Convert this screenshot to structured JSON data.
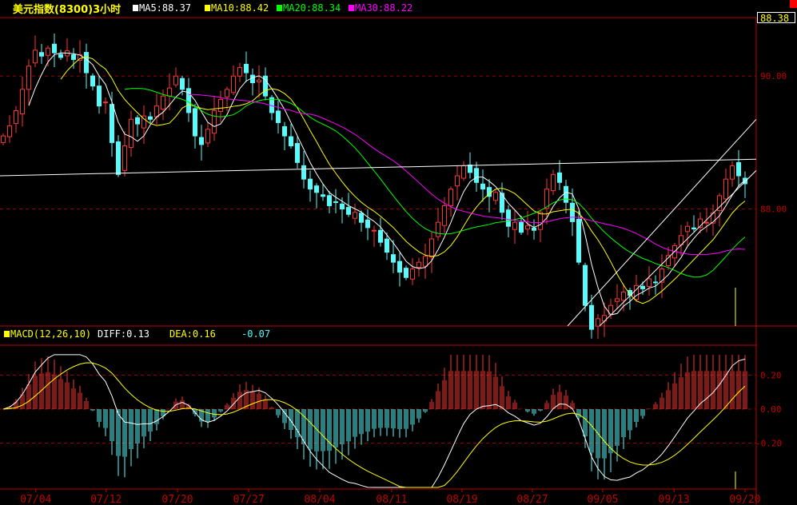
{
  "header": {
    "title": "美元指数(8300)3小时",
    "ma5": "MA5:88.37",
    "ma10": "MA10:88.42",
    "ma20": "MA20:88.34",
    "ma30": "MA30:88.22",
    "current_price": "88.38"
  },
  "macd_header": {
    "name": "MACD(12,26,10)",
    "diff": "DIFF:0.13",
    "dea": "DEA:0.16",
    "macd": "-0.07"
  },
  "colors": {
    "up": "#ff3232",
    "down": "#54fcfc",
    "ma5": "#ffffff",
    "ma10": "#ffff00",
    "ma20": "#00ff00",
    "ma30": "#ff00ff",
    "grid": "#a00000",
    "axis": "#c00000"
  },
  "chart_data": [
    {
      "type": "candlestick",
      "title": "美元指数(8300)3小时",
      "ylim": [
        86.24,
        90.88
      ],
      "yticks": [
        {
          "value": 90,
          "label": "90.00"
        },
        {
          "value": 88,
          "label": "88.00"
        }
      ],
      "closes": [
        89.1,
        89.25,
        89.48,
        89.8,
        90.15,
        90.39,
        90.3,
        90.42,
        90.35,
        90.28,
        90.38,
        90.25,
        90.32,
        90.05,
        89.85,
        89.55,
        89.61,
        89.0,
        88.52,
        88.95,
        89.35,
        89.28,
        89.4,
        89.35,
        89.55,
        89.7,
        89.82,
        90.0,
        89.8,
        89.45,
        89.1,
        88.97,
        89.2,
        89.48,
        89.65,
        89.8,
        90.0,
        90.13,
        90.05,
        89.9,
        89.94,
        89.7,
        89.45,
        89.3,
        89.1,
        88.95,
        88.7,
        88.45,
        88.3,
        88.25,
        88.19,
        88.05,
        88.1,
        88.0,
        87.92,
        87.95,
        87.8,
        87.72,
        87.68,
        87.5,
        87.35,
        87.2,
        87.05,
        86.97,
        87.1,
        87.2,
        87.29,
        87.55,
        87.8,
        88.05,
        88.3,
        88.5,
        88.65,
        88.55,
        88.4,
        88.3,
        88.19,
        88.25,
        87.95,
        87.74,
        87.8,
        87.65,
        87.75,
        87.68,
        87.95,
        88.3,
        88.52,
        88.4,
        88.1,
        87.81,
        87.2,
        86.55,
        86.19,
        86.35,
        86.4,
        86.55,
        86.65,
        86.75,
        86.7,
        86.85,
        86.8,
        86.95,
        86.9,
        87.1,
        87.3,
        87.45,
        87.6,
        87.74,
        87.7,
        87.85,
        87.8,
        87.94,
        88.2,
        88.45,
        88.65,
        88.5,
        88.38
      ],
      "moving_averages": [
        5,
        10,
        20,
        30
      ],
      "trendlines": [
        {
          "from": [
            -0.5,
            88.5
          ],
          "to": [
            117.75,
            88.75
          ]
        },
        {
          "from": [
            88.25,
            86.24
          ],
          "to": [
            117.75,
            89.35
          ]
        },
        {
          "from": [
            93.25,
            86.24
          ],
          "to": [
            117.75,
            88.58
          ]
        }
      ],
      "xticks": [
        {
          "index": 5.1,
          "label": "07/04"
        },
        {
          "index": 16.1,
          "label": "07/12"
        },
        {
          "index": 27.25,
          "label": "07/20"
        },
        {
          "index": 38.4,
          "label": "07/27"
        },
        {
          "index": 49.5,
          "label": "08/04"
        },
        {
          "index": 60.75,
          "label": "08/11"
        },
        {
          "index": 71.75,
          "label": "08/19"
        },
        {
          "index": 82.75,
          "label": "08/27"
        },
        {
          "index": 93.75,
          "label": "09/05"
        },
        {
          "index": 104.9,
          "label": "09/13"
        },
        {
          "index": 116,
          "label": "09/20"
        }
      ]
    },
    {
      "type": "bar",
      "title": "MACD(12,26,10)",
      "ylim": [
        -0.24,
        0.2
      ],
      "yticks": [
        {
          "value": 0.2,
          "label": "0.20"
        },
        {
          "value": 0,
          "label": "0.00"
        },
        {
          "value": -0.2,
          "label": "-0.20"
        }
      ],
      "params": [
        12,
        26,
        10
      ],
      "diff": 0.13,
      "dea": 0.16,
      "macd": -0.07
    }
  ]
}
